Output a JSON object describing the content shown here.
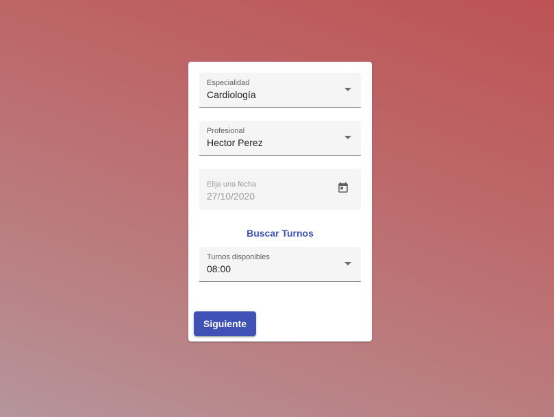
{
  "form": {
    "specialty": {
      "label": "Especialidad",
      "value": "Cardiología",
      "icon": "dropdown-arrow-icon"
    },
    "professional": {
      "label": "Profesional",
      "value": "Hector Perez",
      "icon": "dropdown-arrow-icon"
    },
    "date": {
      "label": "Elija una fecha",
      "value": "27/10/2020",
      "icon": "calendar-icon"
    },
    "search_label": "Buscar Turnos",
    "slots": {
      "label": "Turnos disponibles",
      "value": "08:00",
      "icon": "dropdown-arrow-icon"
    },
    "next_label": "Siguiente"
  },
  "colors": {
    "primary": "#3f51b5",
    "background_start": "#bd5254",
    "background_end": "#b5959c"
  }
}
